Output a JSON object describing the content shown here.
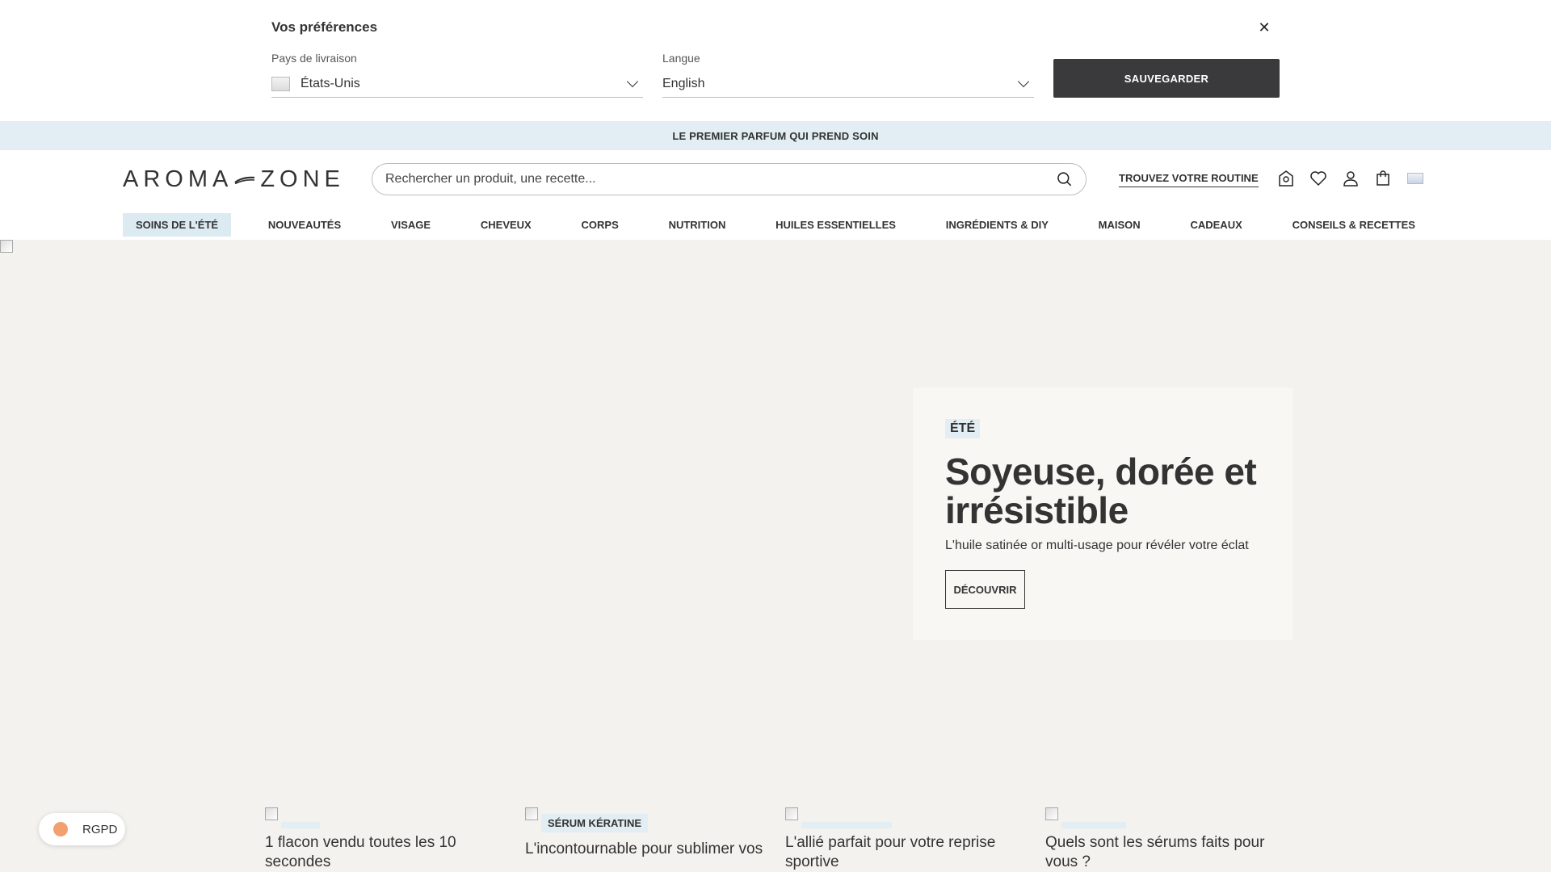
{
  "preferences": {
    "title": "Vos préférences",
    "close_icon": "close-icon",
    "country_label": "Pays de livraison",
    "country_value": "États-Unis",
    "language_label": "Langue",
    "language_value": "English",
    "save_label": "SAUVEGARDER"
  },
  "promo": {
    "text": "LE PREMIER PARFUM QUI PREND SOIN"
  },
  "header": {
    "logo_left": "AROMA",
    "logo_right": "ZONE",
    "search_placeholder": "Rechercher un produit, une recette...",
    "routine_label": "TROUVEZ VOTRE ROUTINE",
    "icons": [
      "store-locator-icon",
      "heart-icon",
      "account-icon",
      "cart-icon",
      "flag-icon"
    ]
  },
  "nav": {
    "items": [
      {
        "label": "SOINS DE L'ÉTÉ",
        "active": true
      },
      {
        "label": "NOUVEAUTÉS"
      },
      {
        "label": "VISAGE"
      },
      {
        "label": "CHEVEUX"
      },
      {
        "label": "CORPS"
      },
      {
        "label": "NUTRITION"
      },
      {
        "label": "HUILES ESSENTIELLES"
      },
      {
        "label": "INGRÉDIENTS & DIY"
      },
      {
        "label": "MAISON"
      },
      {
        "label": "CADEAUX"
      },
      {
        "label": "CONSEILS & RECETTES"
      }
    ]
  },
  "hero": {
    "tag": "ÉTÉ",
    "title": "Soyeuse, dorée et irrésistible",
    "subtitle": "L'huile satinée or multi-usage pour révéler votre éclat",
    "cta": "DÉCOUVRIR"
  },
  "cards": [
    {
      "tag": "",
      "text": "1 flacon vendu toutes les 10 secondes"
    },
    {
      "tag": "SÉRUM KÉRATINE",
      "text": "L'incontournable pour sublimer vos"
    },
    {
      "tag": "",
      "text": "L'allié parfait pour votre reprise sportive"
    },
    {
      "tag": "",
      "text": "Quels sont les sérums faits pour vous ?"
    }
  ],
  "rgpd": {
    "label": "RGPD"
  },
  "colors": {
    "accent_light_blue": "#e2eef3",
    "dark_button": "#3a3a3c",
    "hero_bg": "#f4f2ee"
  }
}
